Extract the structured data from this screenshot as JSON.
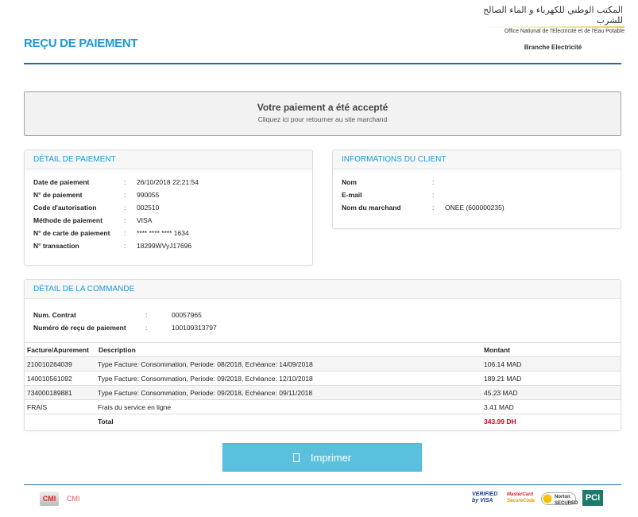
{
  "header": {
    "title": "REÇU DE PAIEMENT",
    "logo_arabic": "المكتب الوطني للكهرباء و الماء الصالح للشرب",
    "logo_french": "Office National de l'Electricité et de l'Eau Potable",
    "branch": "Branche Electricité"
  },
  "success": {
    "title": "Votre paiement a été accepté",
    "link": "Cliquez ici pour retourner au site marchand"
  },
  "payment": {
    "heading": "DÉTAIL DE PAIEMENT",
    "rows": [
      {
        "label": "Date de paiement",
        "value": "26/10/2018 22:21:54"
      },
      {
        "label": "N° de paiement",
        "value": "990055"
      },
      {
        "label": "Code d'autorisation",
        "value": "002510"
      },
      {
        "label": "Méthode de paiement",
        "value": "VISA"
      },
      {
        "label": "N° de carte de paiement",
        "value": "**** **** **** 1634"
      },
      {
        "label": "N° transaction",
        "value": "18299WVyJ17696"
      }
    ]
  },
  "client": {
    "heading": "INFORMATIONS DU CLIENT",
    "rows": [
      {
        "label": "Nom",
        "value": ""
      },
      {
        "label": "E-mail",
        "value": ""
      },
      {
        "label": "Nom du marchand",
        "value": "ONEE (600000235)"
      }
    ]
  },
  "order": {
    "heading": "DÉTAIL DE LA COMMANDE",
    "rows": [
      {
        "label": "Num. Contrat",
        "value": "00057965"
      },
      {
        "label": "Numéro de reçu de paiement",
        "value": "100109313797"
      }
    ],
    "columns": [
      "Facture/Apurement",
      "Description",
      "Montant"
    ],
    "items": [
      {
        "ref": "210010264039",
        "desc": "Type Facture: Consommation, Periode: 08/2018, Echéance: 14/09/2018",
        "amount": "106.14 MAD"
      },
      {
        "ref": "140010561092",
        "desc": "Type Facture: Consommation, Periode: 09/2018, Echéance: 12/10/2018",
        "amount": "189.21 MAD"
      },
      {
        "ref": "734000189881",
        "desc": "Type Facture: Consommation, Periode: 09/2018, Echéance: 09/11/2018",
        "amount": "45.23 MAD"
      },
      {
        "ref": "FRAIS",
        "desc": "Frais du service en ligne",
        "amount": "3.41 MAD"
      }
    ],
    "total_label": "Total",
    "total": "343.99 DH"
  },
  "sep": ":",
  "print": {
    "icon": "print-icon",
    "label": "Imprimer"
  },
  "footer": {
    "cmi": "CMI",
    "cmi_logo": "CMI",
    "badges": [
      "VERIFIED by VISA",
      "MasterCard SecureCode",
      "Norton SECURED",
      "PCI"
    ]
  },
  "colors": {
    "accent": "#1a9ad6",
    "button": "#5bc0de",
    "total": "#d0021b"
  }
}
